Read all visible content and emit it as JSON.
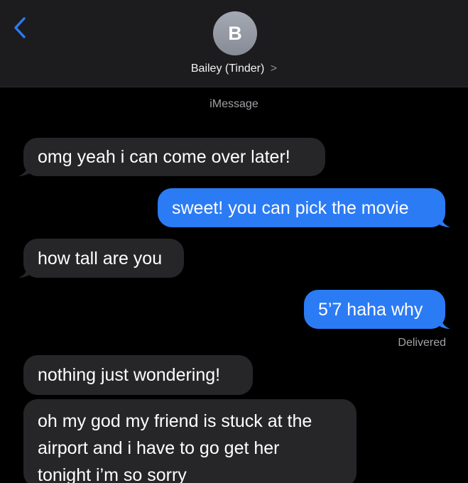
{
  "header": {
    "back_icon": "chevron-left-icon",
    "avatar_initial": "B",
    "contact_name": "Bailey (Tinder)",
    "contact_chevron": ">",
    "accent_color": "#2b7bf5"
  },
  "service_label": "iMessage",
  "messages": [
    {
      "direction": "received",
      "lines": [
        "omg yeah i can come over later!"
      ]
    },
    {
      "direction": "sent",
      "lines": [
        "sweet! you can pick the movie"
      ]
    },
    {
      "direction": "received",
      "lines": [
        "how tall are you"
      ]
    },
    {
      "direction": "sent",
      "lines": [
        "5’7 haha why"
      ]
    },
    {
      "direction": "received",
      "lines": [
        "nothing just wondering!"
      ]
    },
    {
      "direction": "received",
      "lines": [
        "oh my god my friend is stuck at the",
        "airport and i have to go get her",
        "tonight i’m so sorry"
      ]
    }
  ],
  "delivered_label": "Delivered",
  "colors": {
    "background": "#000000",
    "header_background": "#1c1c1e",
    "received_bubble": "#262629",
    "sent_bubble": "#2b7bf5"
  }
}
